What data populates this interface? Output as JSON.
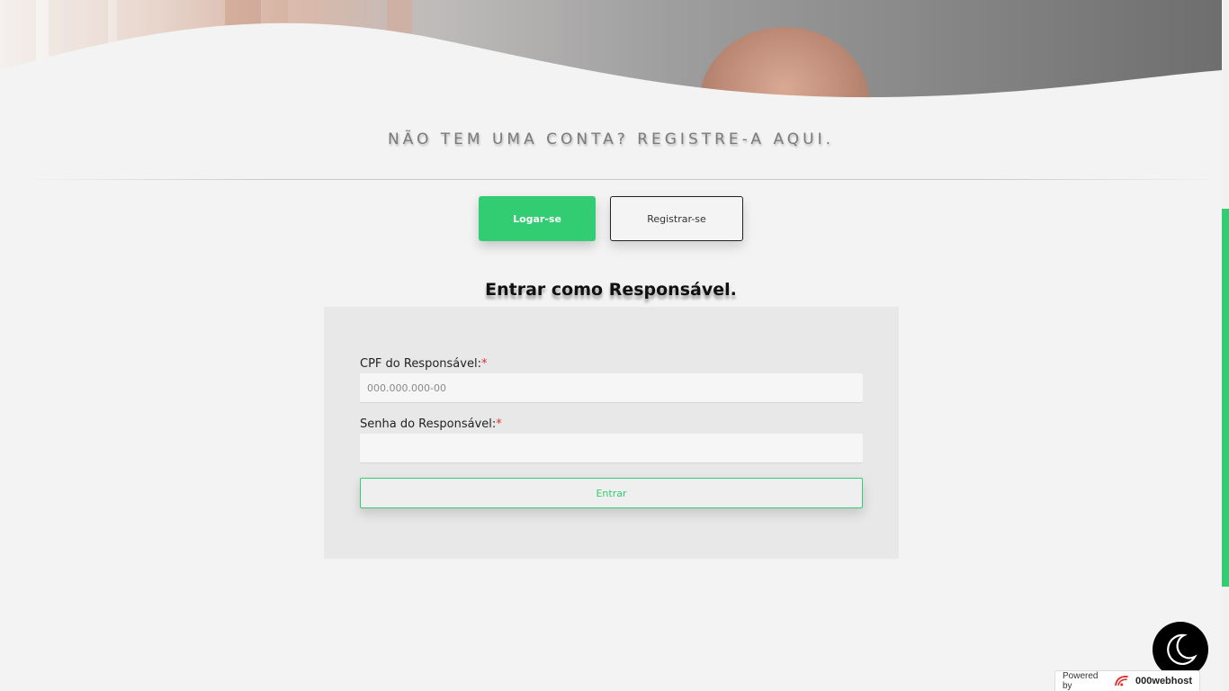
{
  "hero": {
    "image_alt": "Foto de idoso"
  },
  "register_prompt": "NÃO TEM UMA CONTA? REGISTRE-A AQUI.",
  "auth_tabs": {
    "login_label": "Logar-se",
    "register_label": "Registrar-se"
  },
  "form": {
    "title": "Entrar como Responsável.",
    "cpf_label": "CPF do Responsável:",
    "cpf_required": "*",
    "cpf_placeholder": "000.000.000-00",
    "cpf_value": "",
    "password_label": "Senha do Responsável:",
    "password_required": "*",
    "password_value": "",
    "submit_label": "Entrar"
  },
  "powered_badge": {
    "prefix": "Powered by",
    "brand": "000webhost"
  },
  "colors": {
    "accent": "#32cd72",
    "background": "#f3f3f3",
    "card": "#e8e8e8",
    "required": "#e03030"
  },
  "icons": {
    "dark_mode_toggle": "moon-icon",
    "brand_logo": "000webhost-logo-icon"
  }
}
